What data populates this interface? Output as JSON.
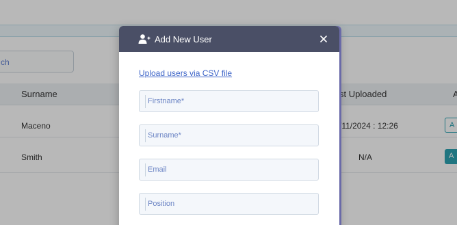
{
  "background": {
    "search_partial": "ch",
    "table": {
      "headers": [
        "Surname",
        "st Uploaded",
        "A"
      ],
      "rows": [
        {
          "surname": "Maceno",
          "last_uploaded": "/11/2024 : 12:26",
          "action": "A"
        },
        {
          "surname": "Smith",
          "last_uploaded": "N/A",
          "action": "A"
        }
      ]
    }
  },
  "modal": {
    "title": "Add New User",
    "icon": "add-user-icon",
    "close_icon": "close-icon",
    "csv_link": "Upload users via CSV file",
    "fields": {
      "firstname": {
        "placeholder": "Firstname*",
        "value": ""
      },
      "surname": {
        "placeholder": "Surname*",
        "value": ""
      },
      "email": {
        "placeholder": "Email",
        "value": ""
      },
      "position": {
        "placeholder": "Position",
        "value": ""
      }
    }
  },
  "colors": {
    "modal_header": "#4a4f66",
    "link": "#3d64c8",
    "accent": "#2ba3b2"
  }
}
